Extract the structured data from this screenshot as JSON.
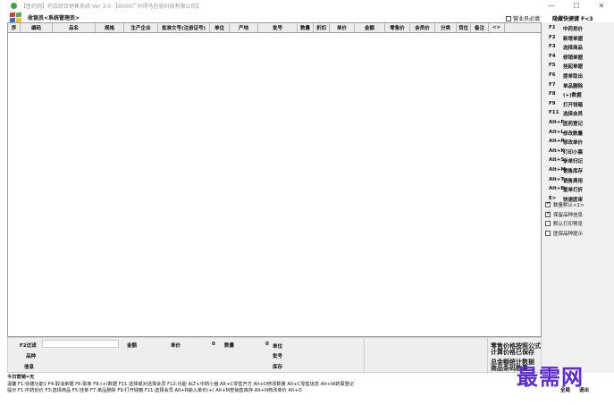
{
  "window": {
    "title": "【医药网】药店综合销售系统 Ver 3.0 【6000广州得马信息科技有限公司】",
    "minimize": "—",
    "maximize": "☐",
    "close": "✕"
  },
  "userbar": {
    "user_text": "收银员<系统管理员>",
    "member_card_label": "营业员必填",
    "member_card_checked": false,
    "hotkey_title": "隐藏快捷键 F<3"
  },
  "grid": {
    "columns": [
      "序",
      "编码",
      "品名",
      "规格",
      "生产企业",
      "批准文号(注册证号)",
      "单位",
      "产地",
      "批号",
      "数量",
      "折扣",
      "单价",
      "金额",
      "零售价",
      "会员价",
      "分类",
      "货位",
      "备注",
      "<>"
    ]
  },
  "shortcuts": [
    {
      "key": "F1",
      "label": "中药划价"
    },
    {
      "key": "F2",
      "label": "新增单据"
    },
    {
      "key": "F3",
      "label": "选择商品"
    },
    {
      "key": "F4",
      "label": "修销单据"
    },
    {
      "key": "F5",
      "label": "挂起单据"
    },
    {
      "key": "F6",
      "label": "提单取出"
    },
    {
      "key": "F7",
      "label": "单品删除"
    },
    {
      "key": "F8",
      "label": "(+)数据"
    },
    {
      "key": "F9",
      "label": "打开钱箱"
    },
    {
      "key": "F11",
      "label": "选择会员"
    },
    {
      "key": "Alt+F",
      "label": "医药登记"
    },
    {
      "key": "Alt+L",
      "label": "修改数量"
    },
    {
      "key": "Alt+P",
      "label": "修改单价"
    },
    {
      "key": "Alt+K",
      "label": "打印小票"
    },
    {
      "key": "Alt+S",
      "label": "录单归记"
    },
    {
      "key": "Alt+M",
      "label": "销售库存"
    },
    {
      "key": "Alt+T",
      "label": "销售费用"
    },
    {
      "key": "Alt+E",
      "label": "整单打折"
    },
    {
      "key": "E>",
      "label": "快速医审"
    }
  ],
  "options": [
    {
      "label": "数量默认<1>",
      "checked": true
    },
    {
      "label": "保留品种信息",
      "checked": true
    },
    {
      "label": "默认打印预览",
      "checked": false
    },
    {
      "label": "医保品种提示",
      "checked": false
    }
  ],
  "bottom": {
    "filter_label": "F2过滤",
    "amount_label": "金额",
    "price_label": "单价",
    "price_value": "0",
    "qty_label": "数量",
    "qty_value": "0",
    "unit_label": "单位",
    "variety_label": "品种",
    "batch_label": "批号",
    "info_label": "信息",
    "stock_label": "库存",
    "big_btn_1": "零售价格按照公式\n计算价格已保存",
    "big_btn_2": "总金额统计数据\n商品条码数量",
    "today_sales": "今日营销=无"
  },
  "status": {
    "line1": "温馨  F1:快捷功能1 F4:取消单据 F6:取单 F8:(+)数据  F11:选择或对选择会员 F12:功能 ALT+中药小盘 Alt+C零售开方 Alt+D修改数量 Alt+C零售信息 Alt+W药事登记",
    "line2": "提示  F1:中药划价 F3:选择商品 F5:挂单 F7:单品删除 F9:打开钱箱 F11:选择会员 Alt+R输入单价(+) Alt+M查销售库存 Alt+N修改单价 Alt+O"
  },
  "watermark": "最需网",
  "corner": {
    "left": "全局",
    "right": "退出"
  }
}
